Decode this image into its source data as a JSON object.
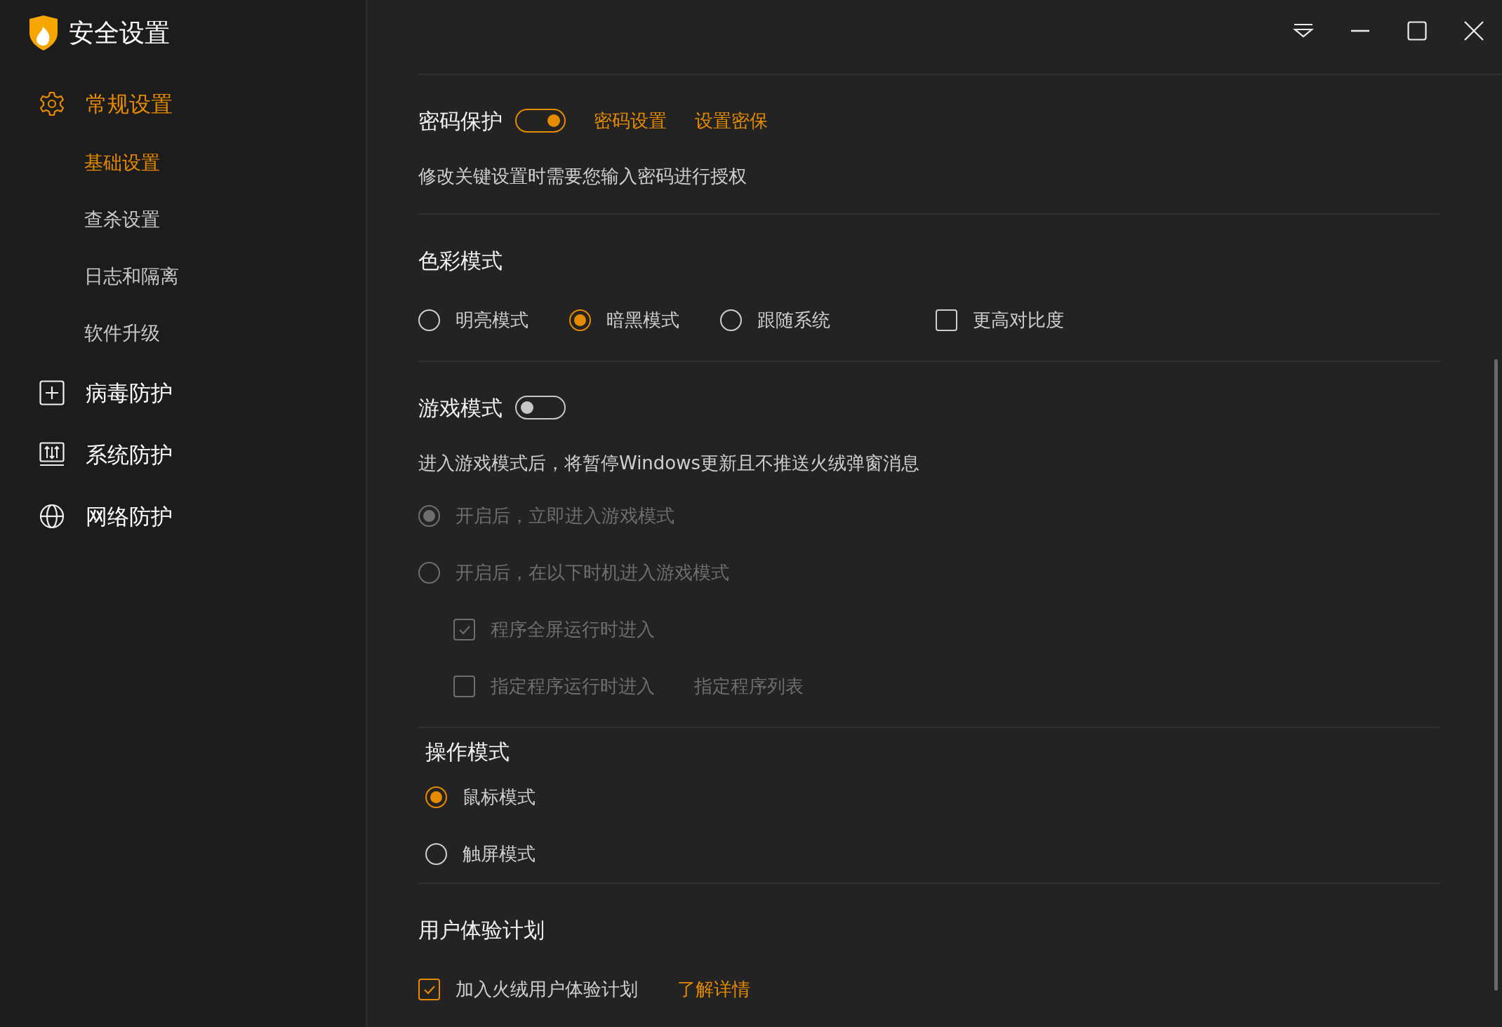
{
  "sidebar": {
    "app_title": "安全设置",
    "items": [
      {
        "label": "常规设置",
        "selected": true,
        "children": [
          {
            "label": "基础设置",
            "selected": true
          },
          {
            "label": "查杀设置",
            "selected": false
          },
          {
            "label": "日志和隔离",
            "selected": false
          },
          {
            "label": "软件升级",
            "selected": false
          }
        ]
      },
      {
        "label": "病毒防护",
        "selected": false
      },
      {
        "label": "系统防护",
        "selected": false
      },
      {
        "label": "网络防护",
        "selected": false
      }
    ]
  },
  "sections": [
    {
      "title": "密码保护",
      "toggle": {
        "on": true
      },
      "links": [
        "密码设置",
        "设置密保"
      ],
      "description": "修改关键设置时需要您输入密码进行授权"
    },
    {
      "title": "色彩模式",
      "options": [
        {
          "kind": "radio",
          "label": "明亮模式",
          "selected": false,
          "disabled": false
        },
        {
          "kind": "radio",
          "label": "暗黑模式",
          "selected": true,
          "disabled": false
        },
        {
          "kind": "radio",
          "label": "跟随系统",
          "selected": false,
          "disabled": false
        },
        {
          "kind": "checkbox",
          "label": "更高对比度",
          "checked": false,
          "disabled": false
        }
      ]
    },
    {
      "title": "游戏模式",
      "toggle": {
        "on": false
      },
      "description": "进入游戏模式后，将暂停Windows更新且不推送火绒弹窗消息",
      "options": [
        {
          "kind": "radio",
          "label": "开启后，立即进入游戏模式",
          "selected": true,
          "disabled": true
        },
        {
          "kind": "radio",
          "label": "开启后，在以下时机进入游戏模式",
          "selected": false,
          "disabled": true,
          "children": [
            {
              "kind": "checkbox",
              "label": "程序全屏运行时进入",
              "checked": true,
              "disabled": true
            },
            {
              "kind": "checkbox",
              "label": "指定程序运行时进入",
              "checked": false,
              "disabled": true,
              "link": "指定程序列表"
            }
          ]
        }
      ]
    },
    {
      "title": "操作模式",
      "options": [
        {
          "kind": "radio",
          "label": "鼠标模式",
          "selected": true,
          "disabled": false
        },
        {
          "kind": "radio",
          "label": "触屏模式",
          "selected": false,
          "disabled": false
        }
      ]
    },
    {
      "title": "用户体验计划",
      "options": [
        {
          "kind": "checkbox",
          "label": "加入火绒用户体验计划",
          "checked": true,
          "disabled": false,
          "link": "了解详情"
        }
      ]
    }
  ]
}
